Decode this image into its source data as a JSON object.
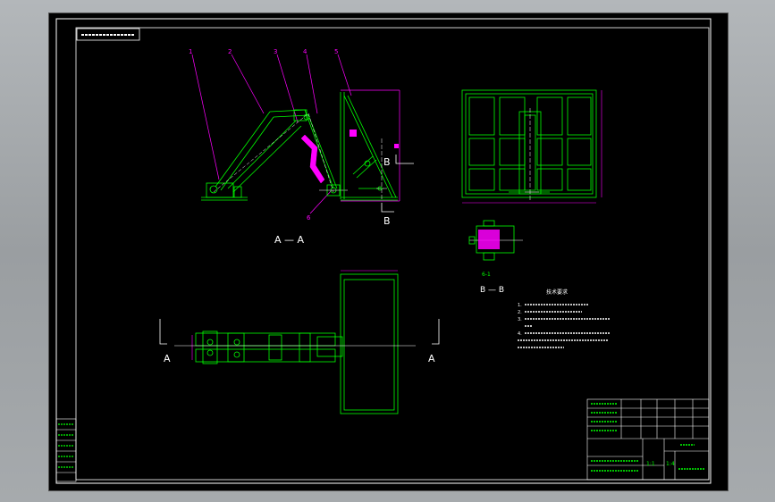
{
  "title_stamp": "",
  "parts": [
    "1",
    "2",
    "3",
    "4",
    "5",
    "6"
  ],
  "sections": {
    "aa_label": "A — A",
    "a_left": "A",
    "a_right": "A",
    "b_top": "B",
    "b_bottom": "B",
    "bb_label": "B — B",
    "detail_label": "6-1"
  },
  "notes": {
    "heading": "技术要求",
    "lines": [
      "1.",
      "2.",
      "3.",
      "4."
    ]
  },
  "title_block": {
    "scale": "1:4",
    "sheet": "1:1",
    "name": ""
  },
  "colors": {
    "frame": "#ffffff",
    "part": "#00ff00",
    "dim": "#ff00ff",
    "center": "#ffffff",
    "hatch": "#ff00ff"
  }
}
